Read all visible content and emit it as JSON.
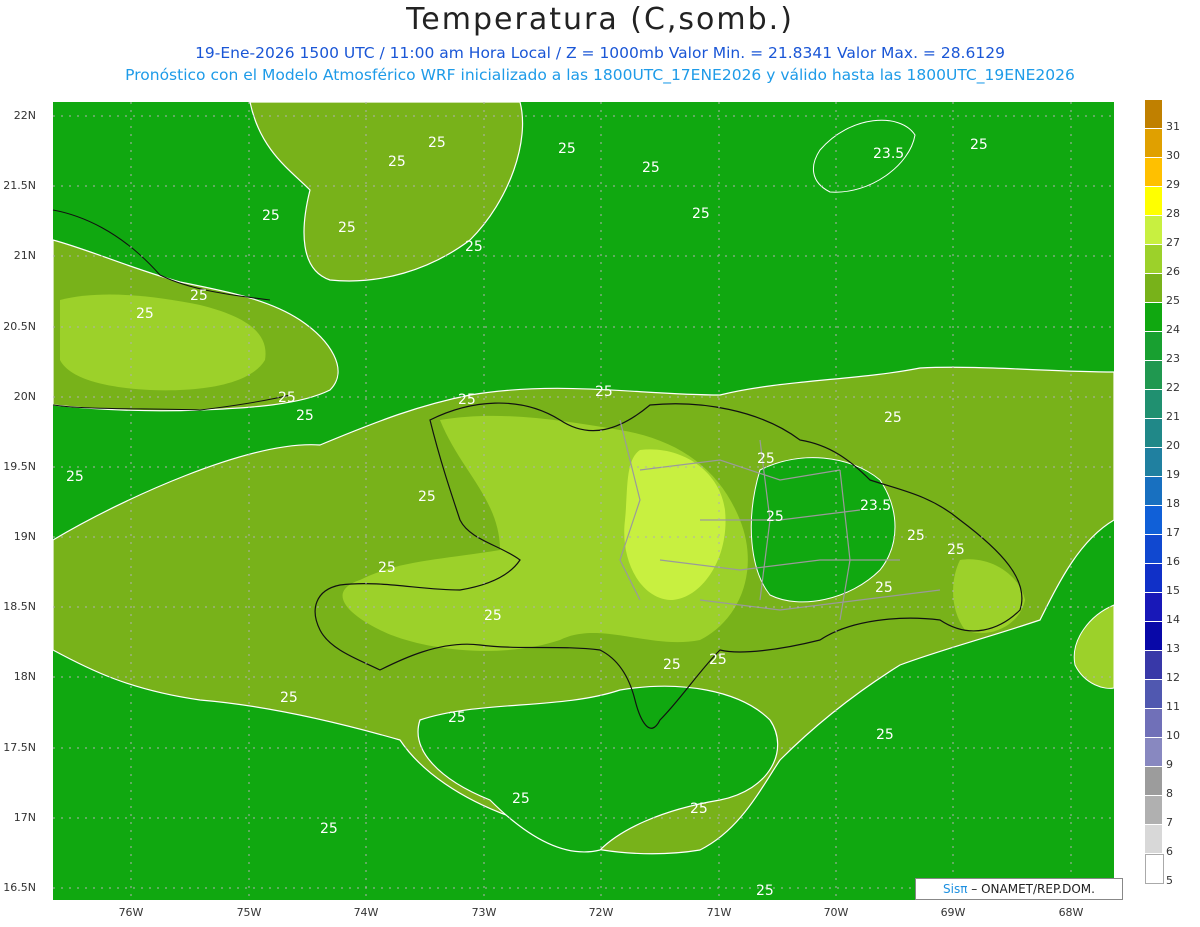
{
  "header": {
    "title": "Temperatura (C,somb.)",
    "subtitle1": "19-Ene-2026 1500 UTC / 11:00 am Hora Local / Z = 1000mb   Valor Min. = 21.8341   Valor Max. = 28.6129",
    "subtitle2": "Pronóstico con el Modelo Atmosférico WRF inicializado a las 1800UTC_17ENE2026 y válido hasta las  1800UTC_19ENE2026"
  },
  "axes": {
    "lat_labels": [
      "22N",
      "21.5N",
      "21N",
      "20.5N",
      "20N",
      "19.5N",
      "19N",
      "18.5N",
      "18N",
      "17.5N",
      "17N",
      "16.5N"
    ],
    "lon_labels": [
      "76W",
      "75W",
      "74W",
      "73W",
      "72W",
      "71W",
      "70W",
      "69W",
      "68W"
    ]
  },
  "contour_labels": [
    "25",
    "23.5"
  ],
  "colorbar": {
    "labels": [
      "31",
      "30",
      "29",
      "28",
      "27",
      "26",
      "25",
      "24",
      "23",
      "22",
      "21",
      "20",
      "19",
      "18",
      "17",
      "16",
      "15",
      "14",
      "13",
      "12",
      "11",
      "10",
      "9",
      "8",
      "7",
      "6",
      "5"
    ],
    "colors": [
      "#c08000",
      "#e0a000",
      "#ffc000",
      "#ffff00",
      "#c8f040",
      "#9cd12a",
      "#78b21a",
      "#10a810",
      "#18a030",
      "#209850",
      "#209070",
      "#208888",
      "#2080a0",
      "#1870c0",
      "#1060d8",
      "#1048d0",
      "#1030c8",
      "#1818b8",
      "#0808a8",
      "#3838a8",
      "#5058b0",
      "#7070b8",
      "#8888c0",
      "#9c9c9c",
      "#b0b0b0",
      "#d8d8d8",
      "#ffffff"
    ]
  },
  "credit": {
    "brand": "Sisπ",
    "text": "– ONAMET/REP.DOM."
  }
}
